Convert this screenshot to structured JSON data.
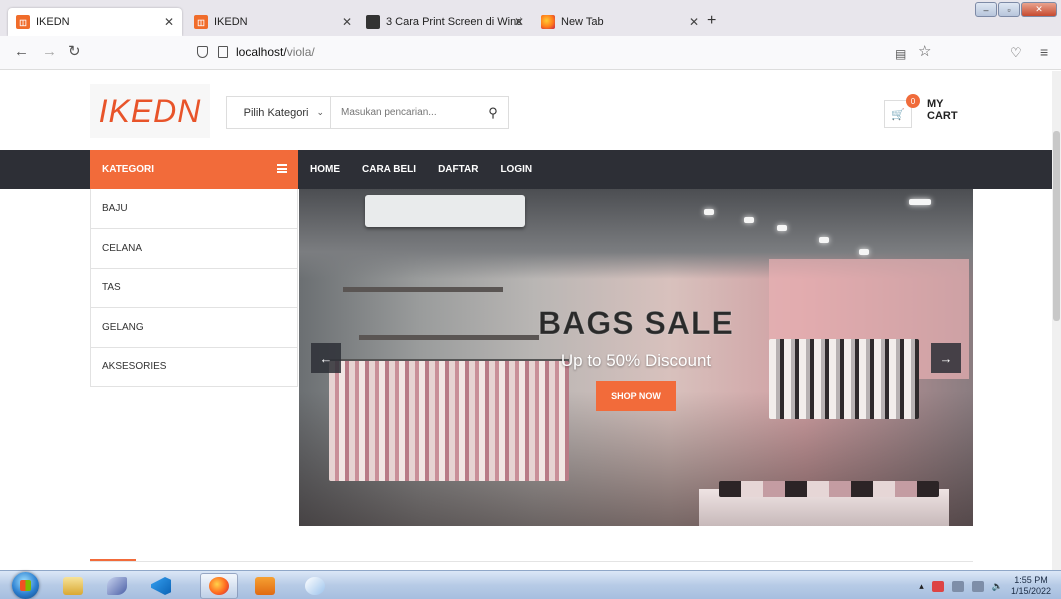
{
  "browser": {
    "tabs": [
      {
        "label": "IKEDN",
        "active": true,
        "favicon": "ikedn-favicon"
      },
      {
        "label": "IKEDN",
        "active": false,
        "favicon": "ikedn-favicon"
      },
      {
        "label": "3 Cara Print Screen di Windows",
        "active": false,
        "favicon": "print-favicon"
      },
      {
        "label": "New Tab",
        "active": false,
        "favicon": "firefox-favicon"
      }
    ],
    "url_host": "localhost/",
    "url_path": "viola/"
  },
  "site": {
    "logo": "IKEDN",
    "search": {
      "category": "Pilih Kategori",
      "placeholder": "Masukan pencarian..."
    },
    "cart": {
      "label": "MY CART",
      "count": "0"
    },
    "menu": {
      "kategori": "KATEGORI",
      "links": [
        "HOME",
        "CARA BELI",
        "DAFTAR",
        "LOGIN"
      ]
    },
    "categories": [
      "BAJU",
      "CELANA",
      "TAS",
      "GELANG",
      "AKSESORIES"
    ],
    "slide": {
      "title": "BAGS SALE",
      "subtitle": "Up to 50% Discount",
      "button": "SHOP NOW",
      "prev": "←",
      "next": "→"
    },
    "accent_color": "#f26b3a",
    "menu_bg_color": "#2d2f36"
  },
  "taskbar": {
    "time": "1:55 PM",
    "date": "1/15/2022"
  }
}
